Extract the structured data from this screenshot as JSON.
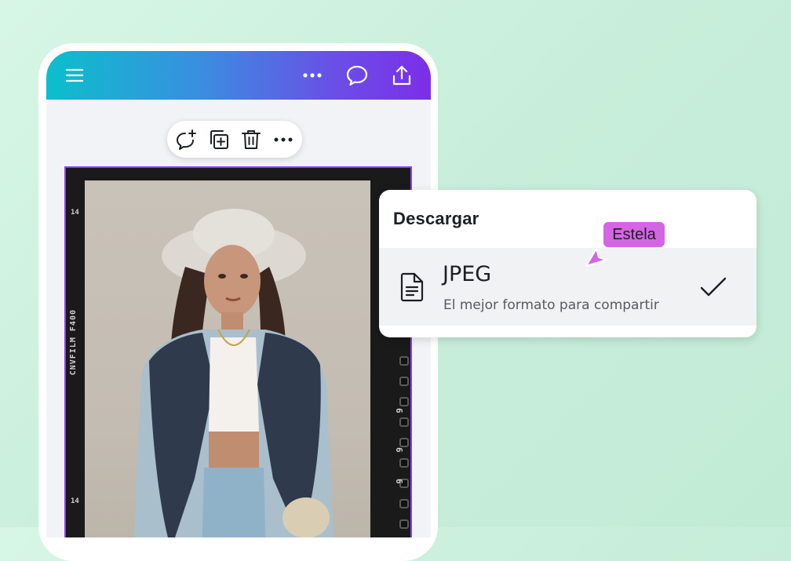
{
  "topbar": {
    "icons": [
      "menu-icon",
      "more-icon",
      "comment-icon",
      "share-icon"
    ]
  },
  "toolbar": {
    "icons": [
      "add-comment-icon",
      "duplicate-icon",
      "delete-icon",
      "more-icon"
    ]
  },
  "photo": {
    "film_label": "CNVFILM F400",
    "film_number_top": "14",
    "film_number_bottom": "14",
    "film_side_number": "6"
  },
  "download_popup": {
    "title": "Descargar",
    "option": {
      "name": "JPEG",
      "description": "El mejor formato para compartir",
      "selected": true,
      "icon": "file-icon"
    }
  },
  "collaborator_cursor": {
    "name": "Estela",
    "color": "#d465e3"
  },
  "colors": {
    "accent": "#8b3dff",
    "background": "#c8eedb"
  }
}
